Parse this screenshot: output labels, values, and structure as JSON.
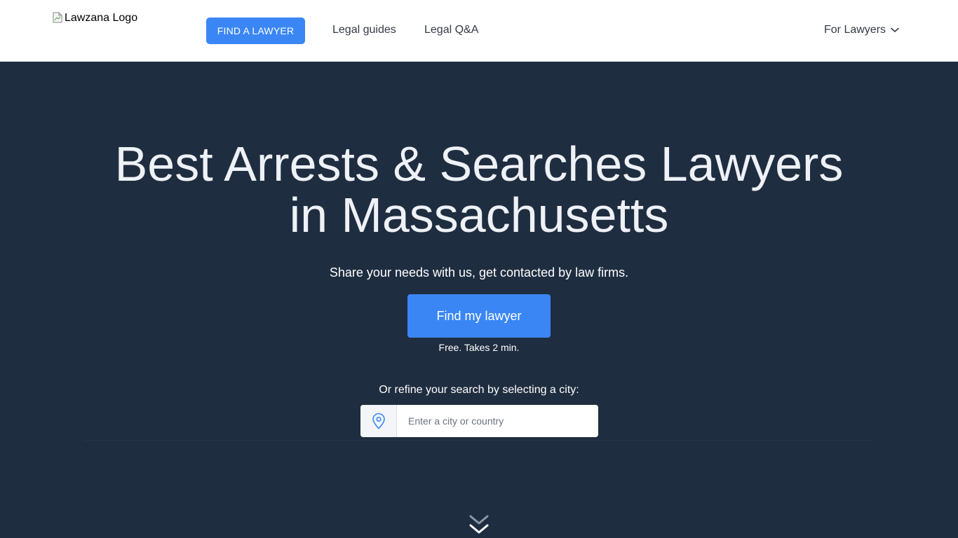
{
  "header": {
    "logo_alt": "Lawzana Logo",
    "find_lawyer_label": "FIND A LAWYER",
    "legal_guides_label": "Legal guides",
    "legal_qa_label": "Legal Q&A",
    "for_lawyers_label": "For Lawyers"
  },
  "hero": {
    "title_line1": "Best Arrests & Searches Lawyers",
    "title_line2": "in Massachusetts",
    "subtitle": "Share your needs with us, get contacted by law firms.",
    "cta_label": "Find my lawyer",
    "cta_note": "Free. Takes 2 min.",
    "refine_label": "Or refine your search by selecting a city:"
  },
  "search": {
    "placeholder": "Enter a city or country",
    "value": "",
    "icon": "map-pin-icon"
  },
  "icons": {
    "dropdown": "chevron-down-icon",
    "scroll": "double-chevron-down-icon",
    "logo": "broken-image-icon"
  },
  "colors": {
    "accent": "#3a86f5",
    "hero_bg": "#1f2d40",
    "header_bg": "#ffffff",
    "nav_text": "#333a45"
  }
}
